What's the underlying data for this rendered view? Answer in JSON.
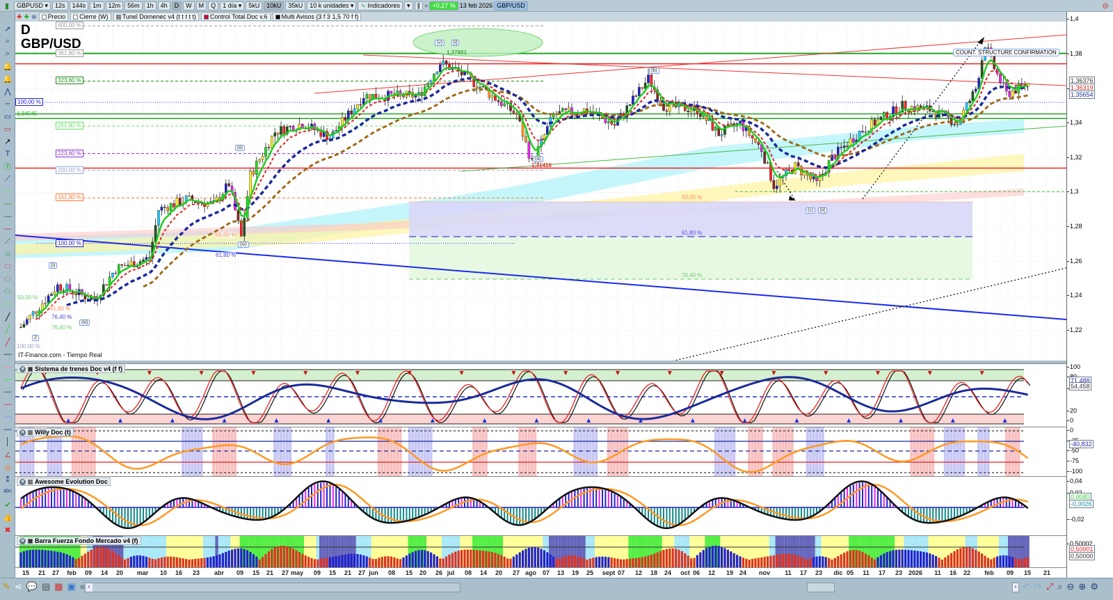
{
  "toolbar": {
    "symbol": "GBPUSD",
    "periods": [
      "12s",
      "144s",
      "1m",
      "12m",
      "56m",
      "1h",
      "4h",
      "D",
      "W",
      "M",
      "Q"
    ],
    "selected_period": "D",
    "range": "1 día",
    "units": [
      "5kU",
      "10kU",
      "35kU"
    ],
    "selected_unit": "10kU",
    "units_dropdown": "10 k unidades",
    "indicators": "Indicadores",
    "change": "+0,27 %",
    "date": "13 feb 2026",
    "pair_badge": "GBP/USD"
  },
  "overlays": [
    {
      "label": "Precio",
      "color": "#ffffff"
    },
    {
      "label": "Cierre (W)",
      "color": "#ffffff"
    },
    {
      "label": "Tunel Domenec v4 (t t t t t)",
      "color": "#888888"
    },
    {
      "label": "Control Total Doc v.6",
      "color": "#cc0044"
    },
    {
      "label": "Multi Avisos (3 f 3 1,5 70 f f)",
      "color": "#000000"
    }
  ],
  "chart": {
    "timeframe": "D",
    "title": "GBP/USD",
    "source": "IT-Finance.com - Tiempo Real",
    "fib_left": [
      {
        "label": "400,00 %",
        "color": "#999999",
        "price": 1.3965
      },
      {
        "label": "361,80 %",
        "color": "#999999",
        "price": 1.3805
      },
      {
        "label": "323,60 %",
        "color": "#1a8a1a",
        "price": 1.3645
      },
      {
        "label": "261,80 %",
        "color": "#66dd66",
        "price": 1.3385
      },
      {
        "label": "223,60 %",
        "color": "#8833cc",
        "price": 1.3225
      },
      {
        "label": "200,00 %",
        "color": "#99aadd",
        "price": 1.3128
      },
      {
        "label": "161,80 %",
        "color": "#ff7733",
        "price": 1.2968
      }
    ],
    "fib_blue": [
      {
        "label": "100,00 %",
        "price": 1.3522
      },
      {
        "label": "100,00 %",
        "price": 1.2705
      }
    ],
    "level_1": "1,34545",
    "fib_mid": [
      {
        "label": "50,00 %",
        "color": "#ff8855"
      },
      {
        "label": "61,80 %",
        "color": "#5555dd"
      },
      {
        "label": "76,40 %",
        "color": "#66cc66"
      }
    ],
    "fib_small": [
      "50,00 %",
      "61,80 %",
      "76,40 %",
      "76,40 %",
      "50,00 %",
      "61,80 %",
      "100,00 %"
    ],
    "waves": [
      "(v)",
      "[i]",
      "(a)",
      "(b)",
      "(c)",
      "[ii]",
      "(i)",
      "(ii)",
      "(iii)",
      "(iv)",
      "2"
    ],
    "high_label": "1,37881",
    "low_label": "1,31416",
    "note": "COUNT. STRUCTURE CONFIRMATION"
  },
  "chart_data": {
    "type": "candlestick",
    "symbol": "GBP/USD",
    "timeframe": "daily",
    "ylim": [
      1.212,
      1.405
    ],
    "yticks": [
      "1,4",
      "1,38",
      "1,36",
      "1,34",
      "1,32",
      "1,3",
      "1,28",
      "1,26",
      "1,24",
      "1,22"
    ],
    "ytick_values": [
      1.4,
      1.38,
      1.36,
      1.34,
      1.32,
      1.3,
      1.28,
      1.26,
      1.24,
      1.22
    ],
    "close_keypoints_day_price": [
      [
        0,
        1.222
      ],
      [
        5,
        1.232
      ],
      [
        12,
        1.246
      ],
      [
        24,
        1.238
      ],
      [
        31,
        1.256
      ],
      [
        42,
        1.262
      ],
      [
        45,
        1.29
      ],
      [
        54,
        1.296
      ],
      [
        63,
        1.293
      ],
      [
        68,
        1.305
      ],
      [
        72,
        1.274
      ],
      [
        75,
        1.31
      ],
      [
        83,
        1.335
      ],
      [
        92,
        1.34
      ],
      [
        101,
        1.332
      ],
      [
        112,
        1.356
      ],
      [
        130,
        1.356
      ],
      [
        137,
        1.375
      ],
      [
        142,
        1.371
      ],
      [
        151,
        1.36
      ],
      [
        162,
        1.345
      ],
      [
        167,
        1.317
      ],
      [
        174,
        1.345
      ],
      [
        185,
        1.348
      ],
      [
        194,
        1.339
      ],
      [
        205,
        1.366
      ],
      [
        210,
        1.35
      ],
      [
        221,
        1.348
      ],
      [
        228,
        1.334
      ],
      [
        235,
        1.34
      ],
      [
        242,
        1.325
      ],
      [
        246,
        1.304
      ],
      [
        253,
        1.315
      ],
      [
        260,
        1.305
      ],
      [
        265,
        1.32
      ],
      [
        274,
        1.335
      ],
      [
        288,
        1.35
      ],
      [
        297,
        1.348
      ],
      [
        306,
        1.34
      ],
      [
        312,
        1.36
      ],
      [
        315,
        1.386
      ],
      [
        318,
        1.372
      ],
      [
        322,
        1.357
      ],
      [
        329,
        1.363
      ]
    ],
    "price_tags": [
      {
        "label": "1,36376",
        "color": "#333333"
      },
      {
        "label": "1,36319",
        "color": "#cc2222"
      },
      {
        "label": "1,35654",
        "color": "#1a2a9a"
      }
    ],
    "xticks": [
      "15",
      "21",
      "27",
      "feb",
      "09",
      "14",
      "20",
      "mar",
      "10",
      "16",
      "23",
      "abr",
      "09",
      "15",
      "21",
      "27",
      "may",
      "09",
      "15",
      "21",
      "27",
      "jun",
      "08",
      "15",
      "20",
      "26",
      "jul",
      "08",
      "14",
      "20",
      "27",
      "ago",
      "07",
      "13",
      "19",
      "25",
      "sept",
      "07",
      "12",
      "18",
      "24",
      "oct",
      "06",
      "12",
      "19",
      "24",
      "nov",
      "11",
      "17",
      "23",
      "dic",
      "05",
      "11",
      "17",
      "23",
      "2026",
      "11",
      "16",
      "22",
      "feb",
      "09",
      "15",
      "21"
    ]
  },
  "panels": [
    {
      "title": "Sistema de trenes Doc v4 (f f)",
      "ticks": [
        "100",
        "80",
        "50",
        "20",
        "0"
      ],
      "tags": [
        {
          "label": "71,488",
          "color": "#2222aa"
        },
        {
          "label": "54,458",
          "color": "#333333"
        }
      ]
    },
    {
      "title": "Willy Doc (t)",
      "ticks": [
        "0",
        "-25",
        "-50",
        "-75",
        "-100"
      ],
      "tags": [
        {
          "label": "-40,832",
          "color": "#2222aa"
        }
      ]
    },
    {
      "title": "Awesome Evolution Doc",
      "ticks": [
        "0,04",
        "0,02",
        "-0,02"
      ],
      "tags": [
        {
          "label": "0,0080",
          "color": "#33cc33"
        },
        {
          "label": "-0,0026",
          "color": "#118899"
        }
      ]
    },
    {
      "title": "Barra Fuerza Fondo Mercado v4 (f)",
      "ticks": [
        "0,50002"
      ],
      "tags": [
        {
          "label": "0,50001",
          "color": "#dd2222"
        },
        {
          "label": "0,50000",
          "color": "#333333"
        }
      ]
    }
  ]
}
